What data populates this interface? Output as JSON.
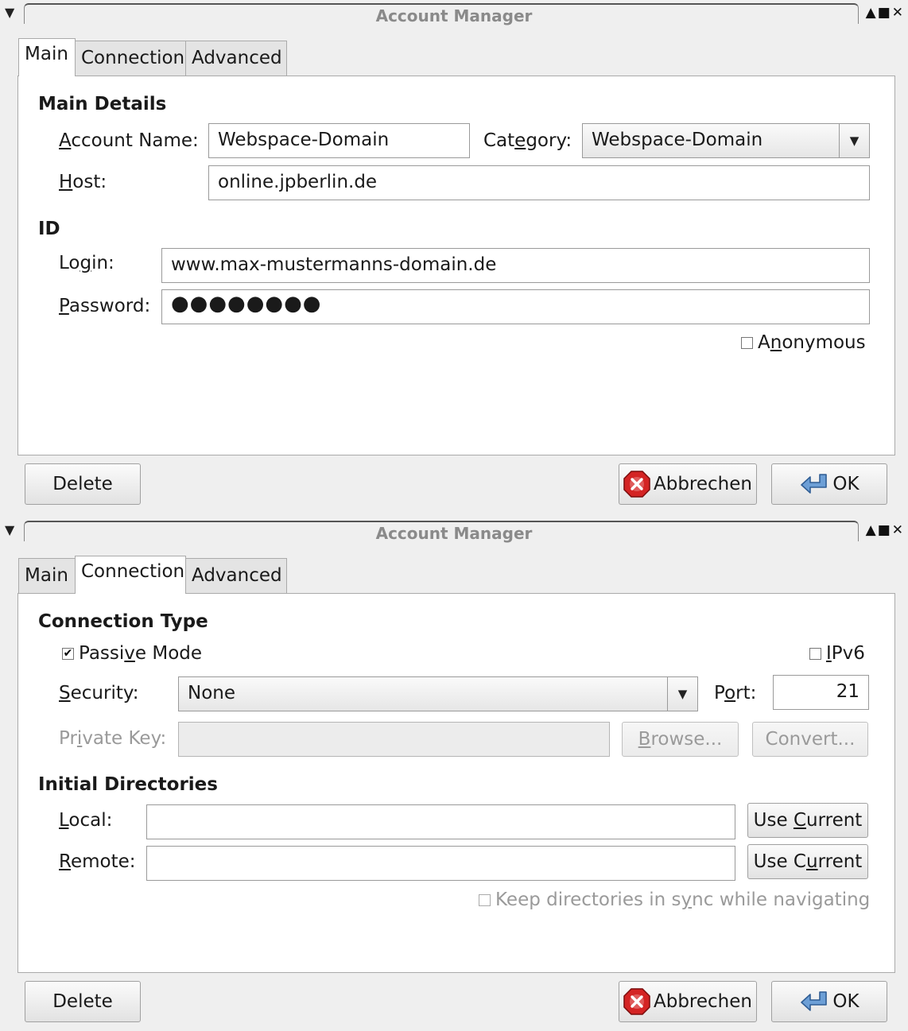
{
  "windows": [
    {
      "title": "Account Manager",
      "tabs": [
        "Main",
        "Connection",
        "Advanced"
      ],
      "active_tab": "Main",
      "main": {
        "section_main": "Main Details",
        "account_name_label": "Account Name:",
        "account_name_value": "Webspace-Domain",
        "category_label": "Category:",
        "category_value": "Webspace-Domain",
        "host_label": "Host:",
        "host_value": "online.jpberlin.de",
        "section_id": "ID",
        "login_label": "Login:",
        "login_value": "www.max-mustermanns-domain.de",
        "password_label": "Password:",
        "password_value": "●●●●●●●●",
        "anonymous_label": "Anonymous",
        "anonymous_checked": false
      },
      "buttons": {
        "delete": "Delete",
        "cancel": "Abbrechen",
        "ok": "OK"
      }
    },
    {
      "title": "Account Manager",
      "tabs": [
        "Main",
        "Connection",
        "Advanced"
      ],
      "active_tab": "Connection",
      "connection": {
        "section_type": "Connection Type",
        "passive_label": "Passive Mode",
        "passive_checked": true,
        "ipv6_label": "IPv6",
        "ipv6_checked": false,
        "security_label": "Security:",
        "security_value": "None",
        "port_label": "Port:",
        "port_value": "21",
        "private_key_label": "Private Key:",
        "private_key_value": "",
        "browse_label": "Browse...",
        "convert_label": "Convert...",
        "section_dirs": "Initial Directories",
        "local_label": "Local:",
        "local_value": "",
        "remote_label": "Remote:",
        "remote_value": "",
        "use_current_local": "Use Current",
        "use_current_remote": "Use Current",
        "sync_label": "Keep directories in sync while navigating",
        "sync_checked": false
      },
      "buttons": {
        "delete": "Delete",
        "cancel": "Abbrechen",
        "ok": "OK"
      }
    }
  ]
}
